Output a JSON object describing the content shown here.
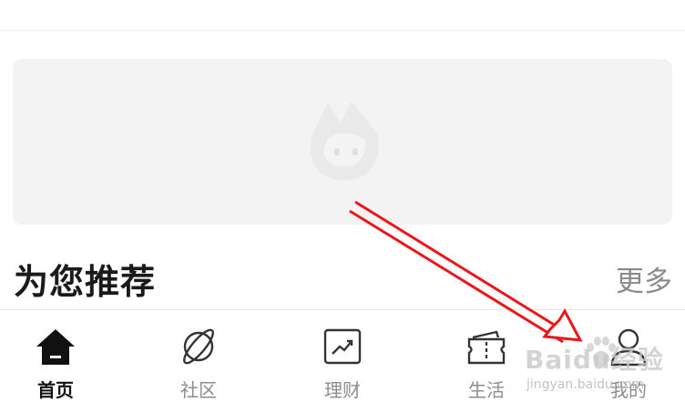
{
  "section": {
    "title": "为您推荐",
    "more_label": "更多"
  },
  "tabs": [
    {
      "label": "首页",
      "icon": "home-icon",
      "active": true
    },
    {
      "label": "社区",
      "icon": "planet-icon",
      "active": false
    },
    {
      "label": "理财",
      "icon": "chart-trend-icon",
      "active": false
    },
    {
      "label": "生活",
      "icon": "ticket-icon",
      "active": false
    },
    {
      "label": "我的",
      "icon": "user-icon",
      "active": false
    }
  ],
  "watermark": {
    "brand": "Baidu经验",
    "url": "jingyan.baidu.com"
  },
  "colors": {
    "annotation_arrow": "#e8171b",
    "active_tab": "#111111",
    "inactive_tab": "#8c8c8c",
    "banner_bg": "#f3f3f3"
  }
}
